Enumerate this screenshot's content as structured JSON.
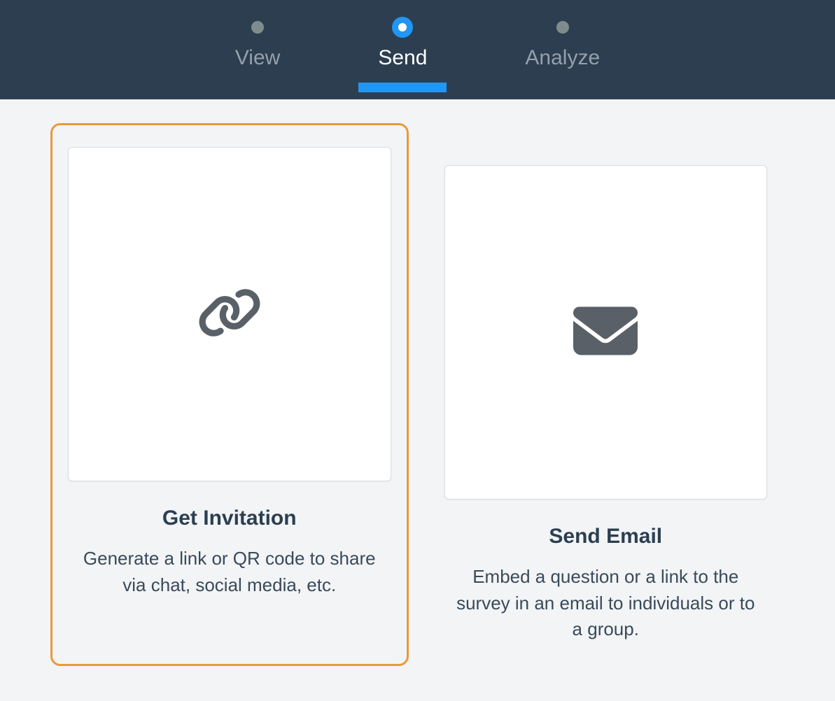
{
  "nav": {
    "tabs": [
      {
        "label": "View",
        "active": false
      },
      {
        "label": "Send",
        "active": true
      },
      {
        "label": "Analyze",
        "active": false
      }
    ]
  },
  "cards": [
    {
      "title": "Get Invitation",
      "description": "Generate a link or QR code to share via chat, social media, etc.",
      "icon": "link-icon",
      "selected": true
    },
    {
      "title": "Send Email",
      "description": "Embed a question or a link to the survey in an email to individuals or to a group.",
      "icon": "envelope-icon",
      "selected": false
    }
  ]
}
